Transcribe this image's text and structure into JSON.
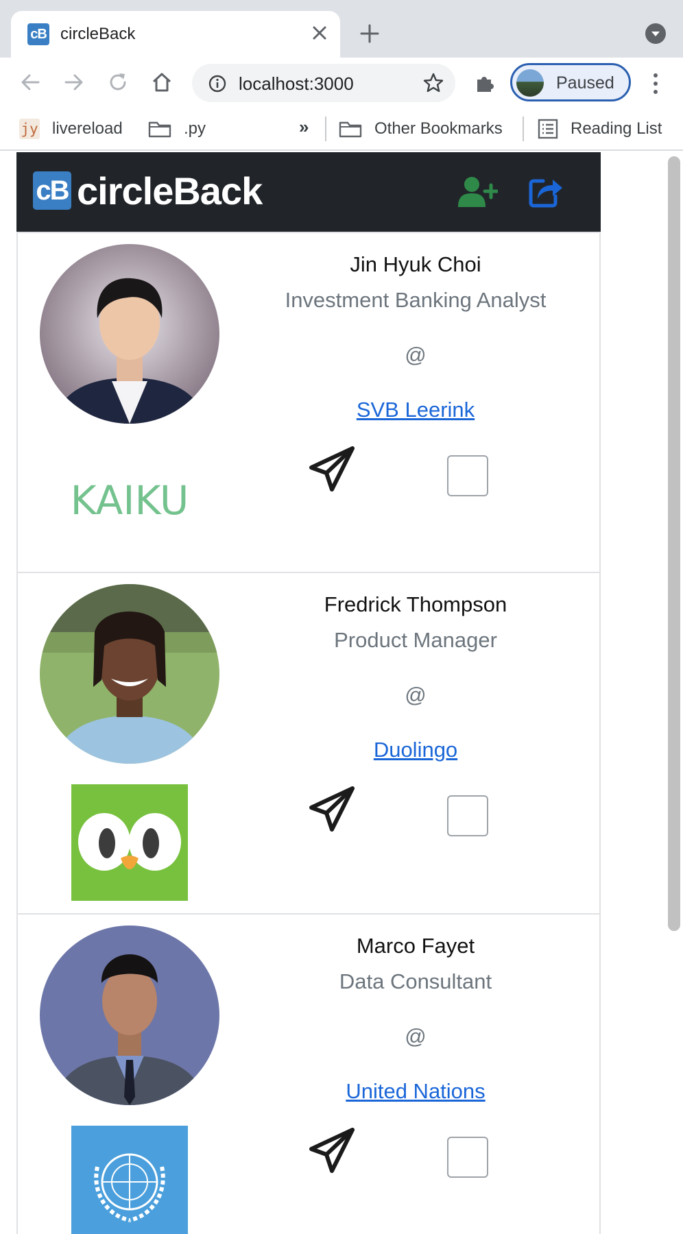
{
  "browser": {
    "tab_title": "circleBack",
    "tab_favicon_text": "cB",
    "url": "localhost:3000",
    "profile_label": "Paused",
    "bookmarks": {
      "item1_badge": "jy",
      "item1_label": "livereload",
      "item2_label": ".py",
      "overflow": "»",
      "other": "Other Bookmarks",
      "reading_list": "Reading List"
    }
  },
  "app": {
    "brand_logo": "cB",
    "brand_name": "circleBack",
    "colors": {
      "navbar": "#212529",
      "add_icon": "#2f8a4a",
      "share_icon": "#1a66d8",
      "link": "#1a66d8"
    }
  },
  "contacts": [
    {
      "name": "Jin Hyuk Choi",
      "title": "Investment Banking Analyst",
      "at": "@",
      "company": "SVB Leerink",
      "logo_text": "KAIKU",
      "sent": false
    },
    {
      "name": "Fredrick Thompson",
      "title": "Product Manager",
      "at": "@",
      "company": "Duolingo",
      "sent": false
    },
    {
      "name": "Marco Fayet",
      "title": "Data Consultant",
      "at": "@",
      "company": "United Nations",
      "sent": false
    }
  ]
}
